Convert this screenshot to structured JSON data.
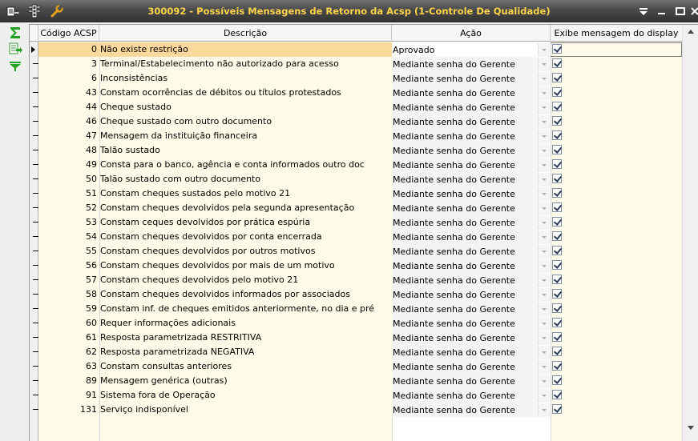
{
  "window": {
    "title": "300092 - Possíveis Mensagens de Retorno da Acsp (1-Controle De Qualidade)"
  },
  "colors": {
    "title_text": "#ffd54a",
    "selected_row": "#fbd89c",
    "row_background": "#fffbe8",
    "sigma_green": "#23a323"
  },
  "toolbar_icons": [
    "menu-export-icon",
    "traffic-light-icon",
    "wrench-icon"
  ],
  "left_toolbar_icons": [
    "sigma-icon",
    "export-sheet-icon",
    "filter-funnel-icon"
  ],
  "window_buttons": [
    "dropdown-arrow-icon",
    "minimize-icon",
    "maximize-icon",
    "close-icon"
  ],
  "grid": {
    "headers": {
      "code": "Código ACSP",
      "description": "Descrição",
      "action": "Ação",
      "display": "Exibe mensagem do display"
    },
    "selected_index": 0,
    "rows": [
      {
        "code": "0",
        "description": "Não existe restrição",
        "action": "Aprovado",
        "display": true
      },
      {
        "code": "3",
        "description": "Terminal/Estabelecimento não autorizado para acesso",
        "action": "Mediante senha do Gerente",
        "display": true
      },
      {
        "code": "6",
        "description": "Inconsistências",
        "action": "Mediante senha do Gerente",
        "display": true
      },
      {
        "code": "43",
        "description": "Constam ocorrências de débitos ou títulos protestados",
        "action": "Mediante senha do Gerente",
        "display": true
      },
      {
        "code": "44",
        "description": "Cheque sustado",
        "action": "Mediante senha do Gerente",
        "display": true
      },
      {
        "code": "46",
        "description": "Cheque sustado com outro documento",
        "action": "Mediante senha do Gerente",
        "display": true
      },
      {
        "code": "47",
        "description": "Mensagem da instituição financeira",
        "action": "Mediante senha do Gerente",
        "display": true
      },
      {
        "code": "48",
        "description": "Talão sustado",
        "action": "Mediante senha do Gerente",
        "display": true
      },
      {
        "code": "49",
        "description": "Consta para o banco, agência e conta informados outro doc",
        "action": "Mediante senha do Gerente",
        "display": true
      },
      {
        "code": "50",
        "description": "Talão sustado com outro documento",
        "action": "Mediante senha do Gerente",
        "display": true
      },
      {
        "code": "51",
        "description": "Constam cheques sustados pelo motivo 21",
        "action": "Mediante senha do Gerente",
        "display": true
      },
      {
        "code": "52",
        "description": "Constam cheques devolvidos pela segunda apresentação",
        "action": "Mediante senha do Gerente",
        "display": true
      },
      {
        "code": "53",
        "description": "Constam ceques devolvidos por prática espúria",
        "action": "Mediante senha do Gerente",
        "display": true
      },
      {
        "code": "54",
        "description": "Constam cheques devolvidos por conta encerrada",
        "action": "Mediante senha do Gerente",
        "display": true
      },
      {
        "code": "55",
        "description": "Constam cheques devolvidos por outros motivos",
        "action": "Mediante senha do Gerente",
        "display": true
      },
      {
        "code": "56",
        "description": "Constam cheques devolvidos por mais de um motivo",
        "action": "Mediante senha do Gerente",
        "display": true
      },
      {
        "code": "57",
        "description": "Constam cheques devolvidos pelo motivo 21",
        "action": "Mediante senha do Gerente",
        "display": true
      },
      {
        "code": "58",
        "description": "Constam cheques devolvidos informados por associados",
        "action": "Mediante senha do Gerente",
        "display": true
      },
      {
        "code": "59",
        "description": "Constam inf. de cheques emitidos anteriormente, no dia e pré",
        "action": "Mediante senha do Gerente",
        "display": true
      },
      {
        "code": "60",
        "description": "Requer informações adicionais",
        "action": "Mediante senha do Gerente",
        "display": true
      },
      {
        "code": "61",
        "description": "Resposta parametrizada RESTRITIVA",
        "action": "Mediante senha do Gerente",
        "display": true
      },
      {
        "code": "62",
        "description": "Resposta parametrizada NEGATIVA",
        "action": "Mediante senha do Gerente",
        "display": true
      },
      {
        "code": "63",
        "description": "Constam consultas anteriores",
        "action": "Mediante senha do Gerente",
        "display": true
      },
      {
        "code": "89",
        "description": "Mensagem genérica (outras)",
        "action": "Mediante senha do Gerente",
        "display": true
      },
      {
        "code": "91",
        "description": "Sistema fora de Operação",
        "action": "Mediante senha do Gerente",
        "display": true
      },
      {
        "code": "131",
        "description": "Serviço indisponível",
        "action": "Mediante senha do Gerente",
        "display": true
      }
    ]
  }
}
